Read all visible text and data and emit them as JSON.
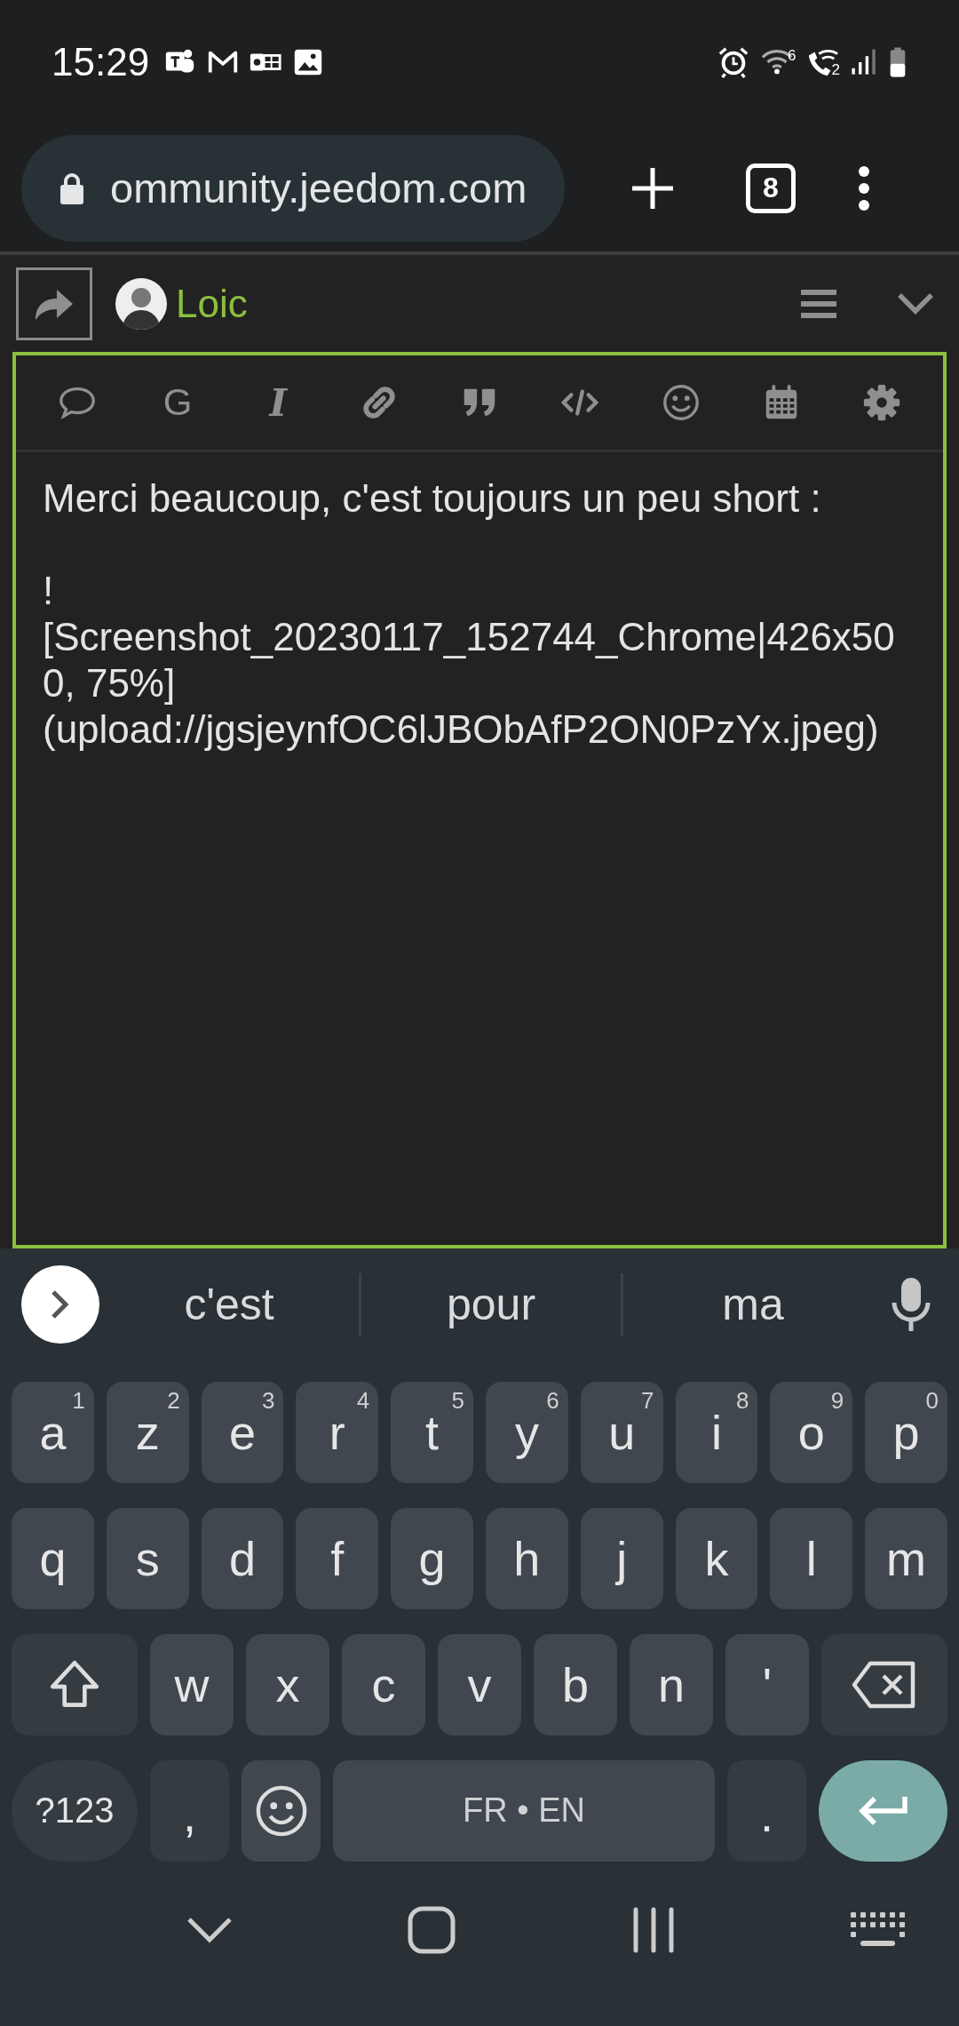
{
  "status_bar": {
    "time": "15:29",
    "notifications": [
      {
        "kind": "teams"
      },
      {
        "kind": "mail"
      },
      {
        "kind": "outlook"
      },
      {
        "kind": "gallery"
      }
    ],
    "indicators": [
      {
        "kind": "alarm"
      },
      {
        "kind": "wifi",
        "badge": "6"
      },
      {
        "kind": "wifi_call",
        "badge": "2"
      },
      {
        "kind": "signal"
      },
      {
        "kind": "battery"
      }
    ]
  },
  "browser": {
    "url": "ommunity.jeedom.com",
    "tab_count": "8"
  },
  "composer": {
    "user": "Loic",
    "toolbar": [
      {
        "kind": "bubble"
      },
      {
        "kind": "letter",
        "label": "G"
      },
      {
        "kind": "italic",
        "label": "I"
      },
      {
        "kind": "link"
      },
      {
        "kind": "quote"
      },
      {
        "kind": "code"
      },
      {
        "kind": "emoji"
      },
      {
        "kind": "calendar"
      },
      {
        "kind": "gear"
      }
    ],
    "paragraphs": [
      [
        "Merci beaucoup, c'est toujours un peu short :"
      ],
      [
        "!",
        "[Screenshot_20230117_152744_Chrome|426x50",
        "0, 75%]",
        "(upload://jgsjeynfOC6lJBObAfP2ON0PzYx.jpeg)"
      ]
    ]
  },
  "keyboard": {
    "suggestions": [
      "c'est",
      "pour",
      "ma"
    ],
    "rows": [
      {
        "keys": [
          {
            "kind": "letter",
            "label": "a",
            "hint": "1"
          },
          {
            "kind": "letter",
            "label": "z",
            "hint": "2"
          },
          {
            "kind": "letter",
            "label": "e",
            "hint": "3"
          },
          {
            "kind": "letter",
            "label": "r",
            "hint": "4"
          },
          {
            "kind": "letter",
            "label": "t",
            "hint": "5"
          },
          {
            "kind": "letter",
            "label": "y",
            "hint": "6"
          },
          {
            "kind": "letter",
            "label": "u",
            "hint": "7"
          },
          {
            "kind": "letter",
            "label": "i",
            "hint": "8"
          },
          {
            "kind": "letter",
            "label": "o",
            "hint": "9"
          },
          {
            "kind": "letter",
            "label": "p",
            "hint": "0"
          }
        ]
      },
      {
        "keys": [
          {
            "kind": "letter",
            "label": "q"
          },
          {
            "kind": "letter",
            "label": "s"
          },
          {
            "kind": "letter",
            "label": "d"
          },
          {
            "kind": "letter",
            "label": "f"
          },
          {
            "kind": "letter",
            "label": "g"
          },
          {
            "kind": "letter",
            "label": "h"
          },
          {
            "kind": "letter",
            "label": "j"
          },
          {
            "kind": "letter",
            "label": "k"
          },
          {
            "kind": "letter",
            "label": "l"
          },
          {
            "kind": "letter",
            "label": "m"
          }
        ]
      },
      {
        "keys": [
          {
            "kind": "shift"
          },
          {
            "kind": "letter",
            "label": "w"
          },
          {
            "kind": "letter",
            "label": "x"
          },
          {
            "kind": "letter",
            "label": "c"
          },
          {
            "kind": "letter",
            "label": "v"
          },
          {
            "kind": "letter",
            "label": "b"
          },
          {
            "kind": "letter",
            "label": "n"
          },
          {
            "kind": "letter",
            "label": "'"
          },
          {
            "kind": "backspace"
          }
        ]
      },
      {
        "keys": [
          {
            "kind": "symbols",
            "label": "?123"
          },
          {
            "kind": "punct",
            "label": ","
          },
          {
            "kind": "emoji"
          },
          {
            "kind": "space",
            "label": "FR • EN"
          },
          {
            "kind": "punct",
            "label": "."
          },
          {
            "kind": "enter"
          }
        ]
      }
    ]
  },
  "nav_bar": [
    {
      "kind": "hide"
    },
    {
      "kind": "home"
    },
    {
      "kind": "recents"
    },
    {
      "kind": "keyboard"
    }
  ]
}
